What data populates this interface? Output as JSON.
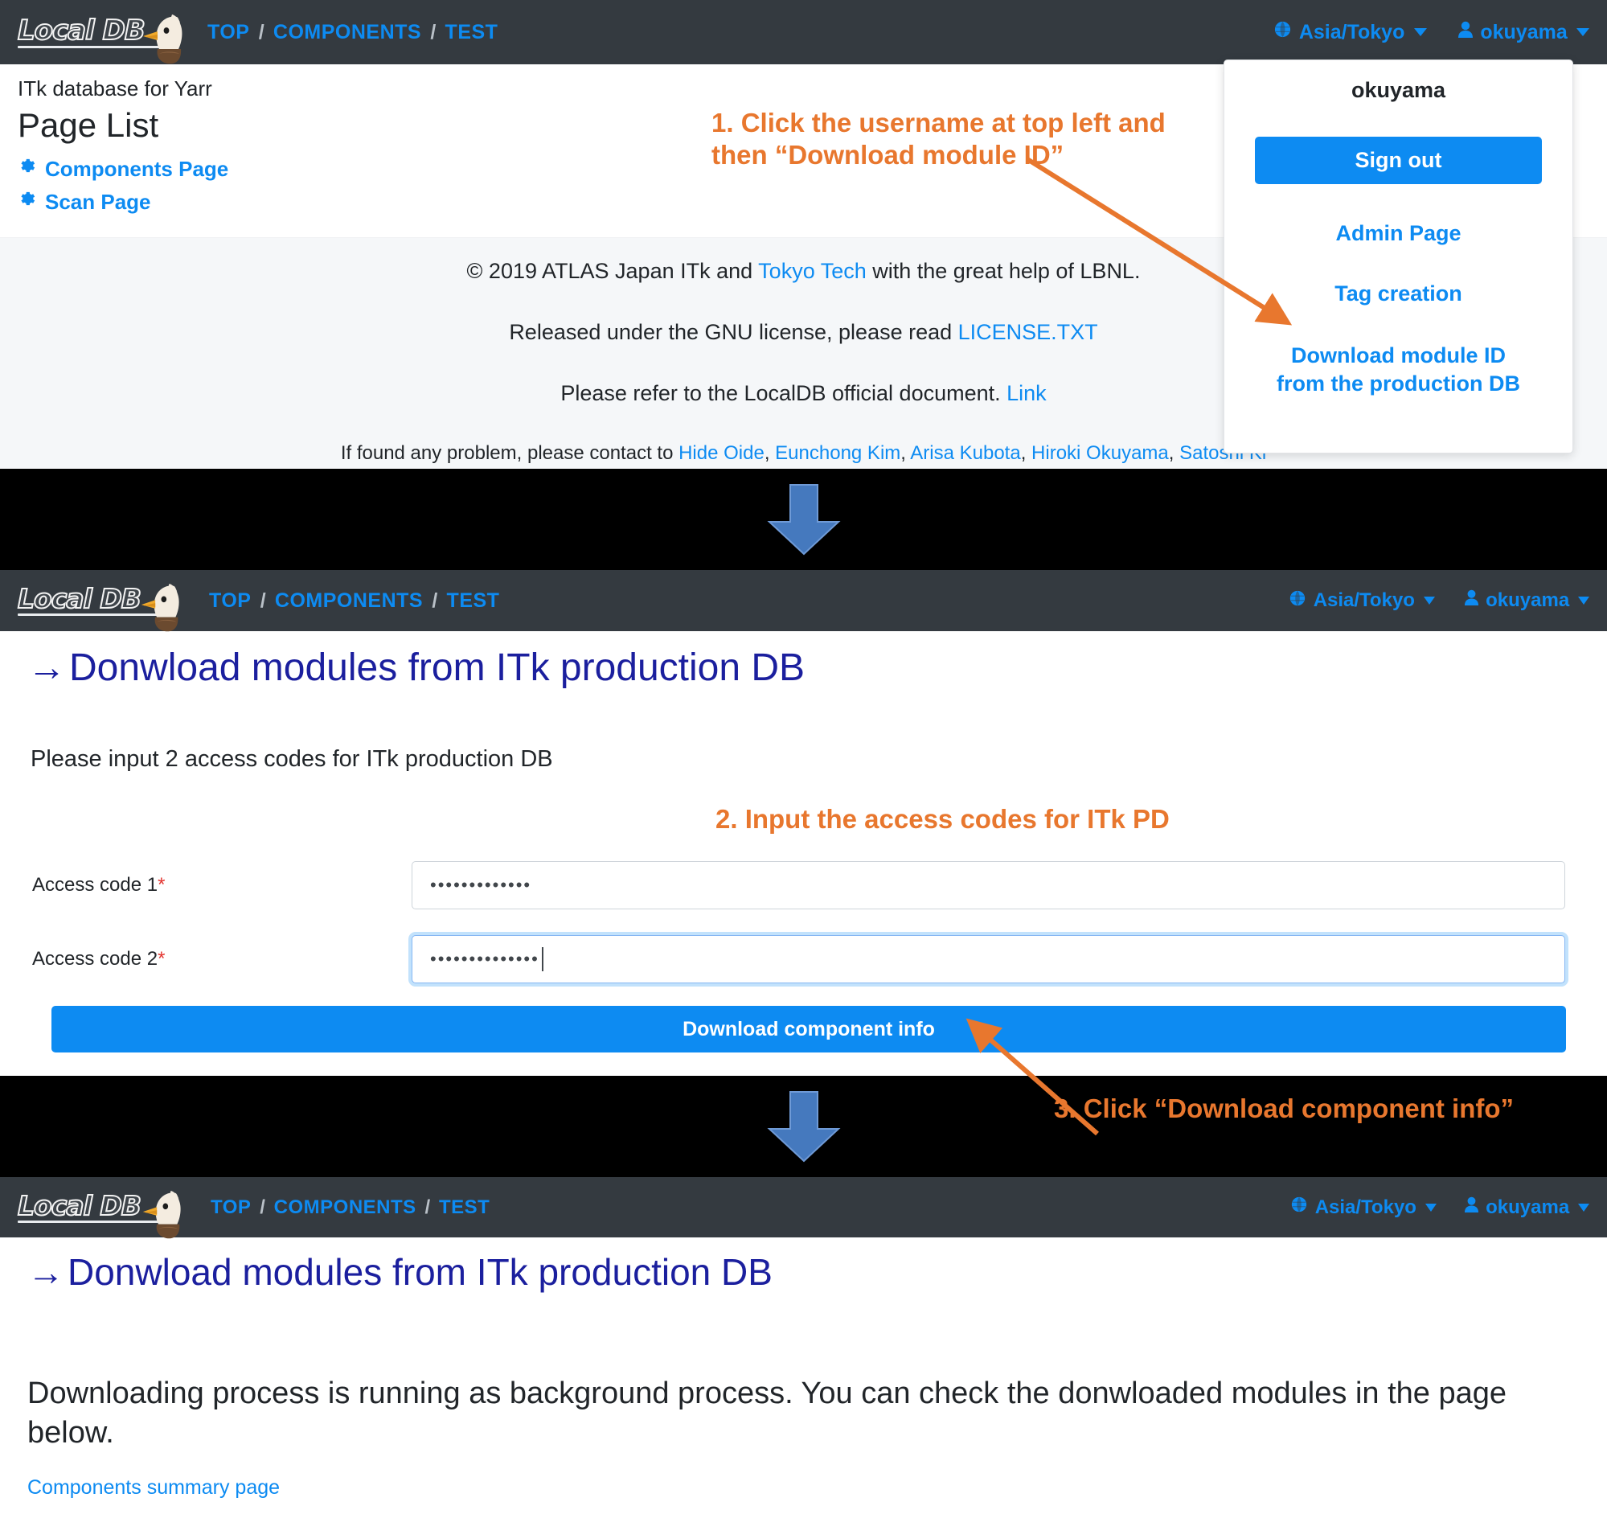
{
  "brand": {
    "logo_text": "Local DB",
    "logo_icon": "eagle-icon"
  },
  "colors": {
    "navbar": "#343a40",
    "link_blue": "#0d8bf2",
    "annotation_orange": "#e8772e",
    "heading_navy": "#1b1f9e",
    "arrow_blue": "#4579be",
    "required_red": "#e3342f"
  },
  "nav": {
    "breadcrumbs": [
      "TOP",
      "COMPONENTS",
      "TEST"
    ],
    "separator": "/",
    "timezone": "Asia/Tokyo",
    "timezone_icon": "globe-icon",
    "user": "okuyama",
    "user_icon": "person-icon",
    "caret_icon": "caret-down-icon"
  },
  "panel1": {
    "subtitle": "ITk database for Yarr",
    "title": "Page List",
    "links": [
      {
        "icon": "gear-icon",
        "label": "Components Page"
      },
      {
        "icon": "gear-icon",
        "label": "Scan Page"
      }
    ],
    "footer": {
      "line1_a": "© 2019 ATLAS Japan ITk and ",
      "line1_link": "Tokyo Tech",
      "line1_b": " with the great help of LBNL.",
      "line2_a": "Released under the GNU license, please read ",
      "line2_link": "LICENSE.TXT",
      "line3_a": "Please refer to the LocalDB official document. ",
      "line3_link": "Link",
      "line4_a": "If found any problem, please contact to ",
      "contacts": [
        "Hide Oide",
        "Eunchong Kim",
        "Arisa Kubota",
        "Hiroki Okuyama",
        "Satoshi Ki"
      ]
    }
  },
  "dropdown": {
    "username": "okuyama",
    "sign_out": "Sign out",
    "items": [
      "Admin Page",
      "Tag creation"
    ],
    "download_item_line1": "Download module ID",
    "download_item_line2": "from the production DB"
  },
  "panel2": {
    "heading_glyph": "→",
    "heading": "Donwload modules from ITk production DB",
    "lead": "Please input 2 access codes for ITk production DB",
    "fields": [
      {
        "label": "Access code 1",
        "required": "*",
        "value": "•••••••••••••",
        "focused": false
      },
      {
        "label": "Access code 2",
        "required": "*",
        "value": "••••••••••••••",
        "focused": true
      }
    ],
    "submit_label": "Download component info"
  },
  "panel3": {
    "heading_glyph": "→",
    "heading": "Donwload modules from ITk production DB",
    "message": "Downloading process is running as background process. You can check the donwloaded modules in the page below.",
    "link": "Components summary page"
  },
  "annotations": [
    {
      "id": "step1",
      "text": "1. Click the username at top left and\nthen “Download module ID”"
    },
    {
      "id": "step2",
      "text": "2. Input the access codes for ITk PD"
    },
    {
      "id": "step3",
      "text": "3. Click “Download component info”"
    }
  ],
  "separators": {
    "arrow_icon": "arrow-down-icon",
    "count": 2
  }
}
